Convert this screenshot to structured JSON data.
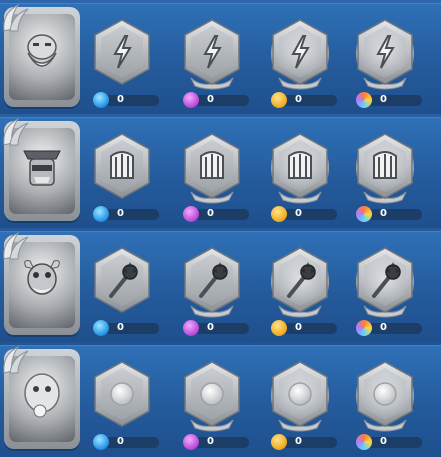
{
  "heroes": [
    {
      "name": "lightning-hero",
      "portrait_icon": "bearded-warrior-portrait",
      "medals": [
        {
          "tier": "blue",
          "icon": "lightning-bolt-icon",
          "count": "0"
        },
        {
          "tier": "purple",
          "icon": "lightning-bolt-icon",
          "count": "0"
        },
        {
          "tier": "gold",
          "icon": "lightning-bolt-icon",
          "count": "0"
        },
        {
          "tier": "prismatic",
          "icon": "lightning-bolt-icon",
          "count": "0"
        }
      ]
    },
    {
      "name": "harp-hero",
      "portrait_icon": "masked-pirate-portrait",
      "medals": [
        {
          "tier": "blue",
          "icon": "harp-icon",
          "count": "0"
        },
        {
          "tier": "purple",
          "icon": "harp-icon",
          "count": "0"
        },
        {
          "tier": "gold",
          "icon": "harp-icon",
          "count": "0"
        },
        {
          "tier": "prismatic",
          "icon": "harp-icon",
          "count": "0"
        }
      ]
    },
    {
      "name": "mace-hero",
      "portrait_icon": "horned-brute-portrait",
      "medals": [
        {
          "tier": "blue",
          "icon": "mace-icon",
          "count": "0"
        },
        {
          "tier": "purple",
          "icon": "mace-icon",
          "count": "0"
        },
        {
          "tier": "gold",
          "icon": "mace-icon",
          "count": "0"
        },
        {
          "tier": "prismatic",
          "icon": "mace-icon",
          "count": "0"
        }
      ]
    },
    {
      "name": "spirit-hero",
      "portrait_icon": "furry-yeti-portrait",
      "medals": [
        {
          "tier": "blue",
          "icon": "orb-icon",
          "count": "0"
        },
        {
          "tier": "purple",
          "icon": "orb-icon",
          "count": "0"
        },
        {
          "tier": "gold",
          "icon": "orb-icon",
          "count": "0"
        },
        {
          "tier": "prismatic",
          "icon": "orb-icon",
          "count": "0"
        }
      ]
    }
  ],
  "colors": {
    "background": "#1f4f8d",
    "row_top": "#2f70b7",
    "count_bar": "#1c3d66",
    "blue_gem": "#1f8ee6",
    "purple_gem": "#b545d8",
    "gold_gem": "#f0a81a"
  }
}
